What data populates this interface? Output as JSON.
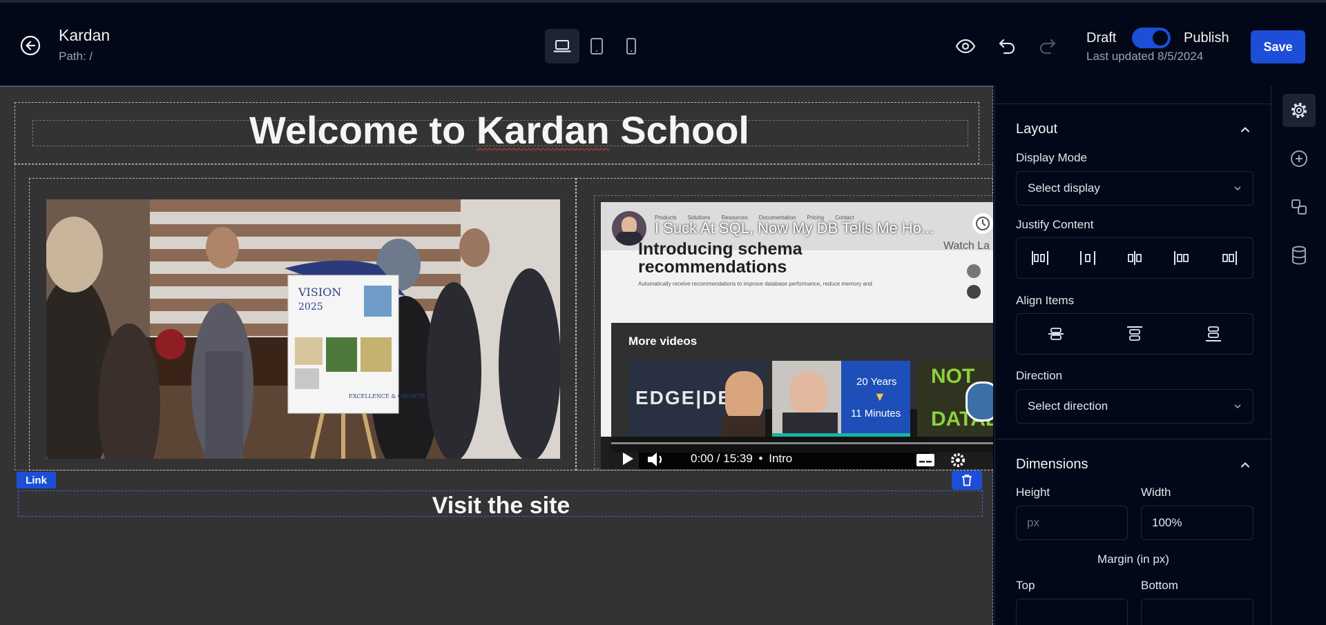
{
  "header": {
    "site_name": "Kardan",
    "path": "Path: /",
    "draft_label": "Draft",
    "publish_label": "Publish",
    "publish_toggle_on": true,
    "last_updated": "Last updated 8/5/2024",
    "save_label": "Save",
    "active_device": "desktop"
  },
  "canvas": {
    "title_prefix": "Welcome to ",
    "title_kardan": "Kardan",
    "title_suffix": " School",
    "link_badge": "Link",
    "visit_text": "Visit the site",
    "photo": {
      "poster_title": "VISION",
      "poster_year": "2025",
      "poster_footer": "EXCELLENCE & GROWTH"
    },
    "video": {
      "title": "I Suck At SQL, Now My DB Tells Me Ho...",
      "watch_later": "Watch La",
      "nav_items": [
        "Products",
        "Solutions",
        "Resources",
        "Documentation",
        "Pricing",
        "Contact"
      ],
      "page_heading_1": "Introducing schema",
      "page_heading_2": "recommendations",
      "page_body": "Automatically receive recommendations to improve database performance, reduce memory and",
      "more_videos": "More videos",
      "thumb1_text": "EDGE|DB",
      "thumb2_line1": "20 Years",
      "thumb2_line2": "11 Minutes",
      "thumb3_line1": "NOT",
      "thumb3_line2": "DATAB",
      "time": "0:00 / 15:39",
      "chapter": "Intro"
    }
  },
  "panel": {
    "layout_title": "Layout",
    "display_mode_label": "Display Mode",
    "display_mode_value": "Select display",
    "justify_label": "Justify Content",
    "align_label": "Align Items",
    "direction_label": "Direction",
    "direction_value": "Select direction",
    "dimensions_title": "Dimensions",
    "height_label": "Height",
    "height_placeholder": "px",
    "width_label": "Width",
    "width_value": "100%",
    "margin_label": "Margin (in px)",
    "top_label": "Top",
    "bottom_label": "Bottom"
  },
  "rail": {
    "items": [
      "settings-icon",
      "add-icon",
      "layers-icon",
      "database-icon"
    ],
    "active": "settings-icon"
  },
  "colors": {
    "accent": "#1d4ed8",
    "background": "#020817",
    "canvas": "#333333"
  }
}
